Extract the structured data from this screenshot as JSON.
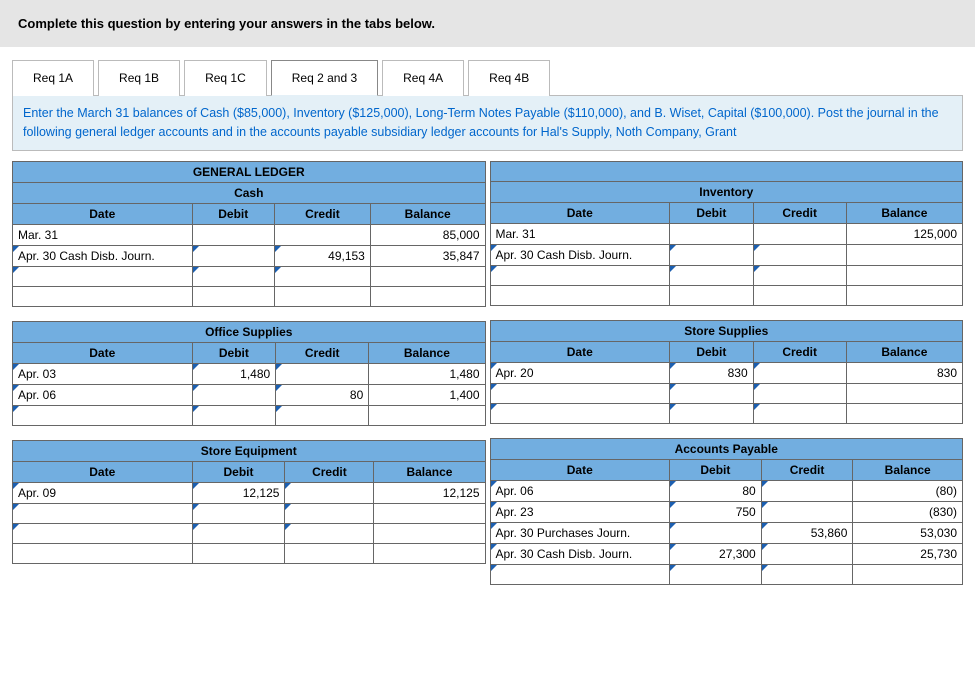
{
  "header": "Complete this question by entering your answers in the tabs below.",
  "tabs": [
    "Req 1A",
    "Req 1B",
    "Req 1C",
    "Req 2 and 3",
    "Req 4A",
    "Req 4B"
  ],
  "instruction": "Enter the March 31 balances of Cash ($85,000), Inventory ($125,000), Long-Term Notes Payable ($110,000), and B. Wiset, Capital ($100,000). Post the journal in the following general ledger accounts and in the accounts payable subsidiary ledger accounts for Hal's Supply, Noth Company, Grant",
  "general_ledger_label": "GENERAL LEDGER",
  "cols": {
    "date": "Date",
    "debit": "Debit",
    "credit": "Credit",
    "balance": "Balance"
  },
  "ledgers": {
    "cash": {
      "title": "Cash",
      "rows": [
        {
          "date": "Mar. 31",
          "debit": "",
          "credit": "",
          "balance": "85,000"
        },
        {
          "date": "Apr. 30 Cash Disb. Journ.",
          "debit": "",
          "credit": "49,153",
          "balance": "35,847"
        },
        {
          "date": "",
          "debit": "",
          "credit": "",
          "balance": ""
        },
        {
          "date": "",
          "debit": "",
          "credit": "",
          "balance": ""
        }
      ]
    },
    "inventory": {
      "title": "Inventory",
      "rows": [
        {
          "date": "Mar. 31",
          "debit": "",
          "credit": "",
          "balance": "125,000"
        },
        {
          "date": "Apr. 30 Cash Disb. Journ.",
          "debit": "",
          "credit": "",
          "balance": ""
        },
        {
          "date": "",
          "debit": "",
          "credit": "",
          "balance": ""
        },
        {
          "date": "",
          "debit": "",
          "credit": "",
          "balance": ""
        }
      ]
    },
    "office_supplies": {
      "title": "Office Supplies",
      "rows": [
        {
          "date": "Apr. 03",
          "debit": "1,480",
          "credit": "",
          "balance": "1,480"
        },
        {
          "date": "Apr. 06",
          "debit": "",
          "credit": "80",
          "balance": "1,400"
        },
        {
          "date": "",
          "debit": "",
          "credit": "",
          "balance": ""
        }
      ]
    },
    "store_supplies": {
      "title": "Store Supplies",
      "rows": [
        {
          "date": "Apr. 20",
          "debit": "830",
          "credit": "",
          "balance": "830"
        },
        {
          "date": "",
          "debit": "",
          "credit": "",
          "balance": ""
        },
        {
          "date": "",
          "debit": "",
          "credit": "",
          "balance": ""
        }
      ]
    },
    "store_equipment": {
      "title": "Store Equipment",
      "rows": [
        {
          "date": "Apr. 09",
          "debit": "12,125",
          "credit": "",
          "balance": "12,125"
        },
        {
          "date": "",
          "debit": "",
          "credit": "",
          "balance": ""
        },
        {
          "date": "",
          "debit": "",
          "credit": "",
          "balance": ""
        },
        {
          "date": "",
          "debit": "",
          "credit": "",
          "balance": ""
        }
      ]
    },
    "accounts_payable": {
      "title": "Accounts Payable",
      "rows": [
        {
          "date": "Apr. 06",
          "debit": "80",
          "credit": "",
          "balance": "(80)"
        },
        {
          "date": "Apr. 23",
          "debit": "750",
          "credit": "",
          "balance": "(830)"
        },
        {
          "date": "Apr. 30 Purchases Journ.",
          "debit": "",
          "credit": "53,860",
          "balance": "53,030"
        },
        {
          "date": "Apr. 30 Cash Disb. Journ.",
          "debit": "27,300",
          "credit": "",
          "balance": "25,730"
        },
        {
          "date": "",
          "debit": "",
          "credit": "",
          "balance": ""
        }
      ]
    }
  }
}
